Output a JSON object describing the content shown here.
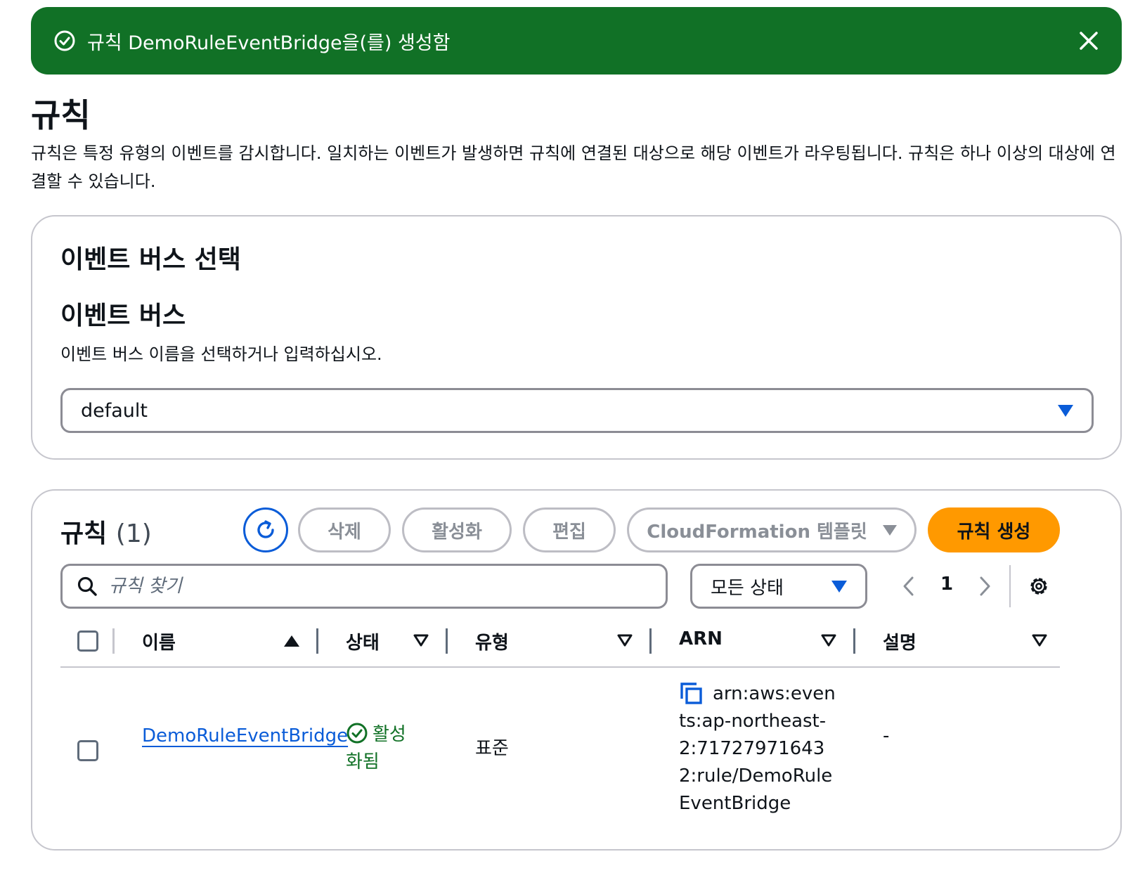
{
  "flash": {
    "message": "규칙 DemoRuleEventBridge을(를) 생성함",
    "icon": "check-circle-icon",
    "close_icon": "close-icon",
    "color": "#117126"
  },
  "page": {
    "title": "규칙",
    "description": "규칙은 특정 유형의 이벤트를 감시합니다. 일치하는 이벤트가 발생하면 규칙에 연결된 대상으로 해당 이벤트가 라우팅됩니다. 규칙은 하나 이상의 대상에 연결할 수 있습니다."
  },
  "bus_panel": {
    "heading": "이벤트 버스 선택",
    "field_label": "이벤트 버스",
    "field_hint": "이벤트 버스 이름을 선택하거나 입력하십시오.",
    "selected_value": "default"
  },
  "rules_panel": {
    "title": "규칙",
    "count": "(1)",
    "actions": {
      "delete": "삭제",
      "enable": "활성화",
      "edit": "편집",
      "cloudformation": "CloudFormation 템플릿",
      "create": "규칙 생성"
    },
    "search": {
      "placeholder": "규칙 찾기",
      "value": ""
    },
    "status_filter": "모든 상태",
    "pagination": {
      "current_page": "1"
    },
    "columns": [
      "이름",
      "상태",
      "유형",
      "ARN",
      "설명"
    ],
    "rows": [
      {
        "name": "DemoRuleEventBridge",
        "status": "활성화됨",
        "type": "표준",
        "arn": "arn:aws:events:ap-northeast-2:717279716432:rule/DemoRuleEventBridge",
        "description": "-"
      }
    ]
  },
  "colors": {
    "accent_blue": "#0a5cd8",
    "primary_orange": "#ff9900",
    "success_green": "#117126",
    "border_gray": "#c6c6cd"
  }
}
